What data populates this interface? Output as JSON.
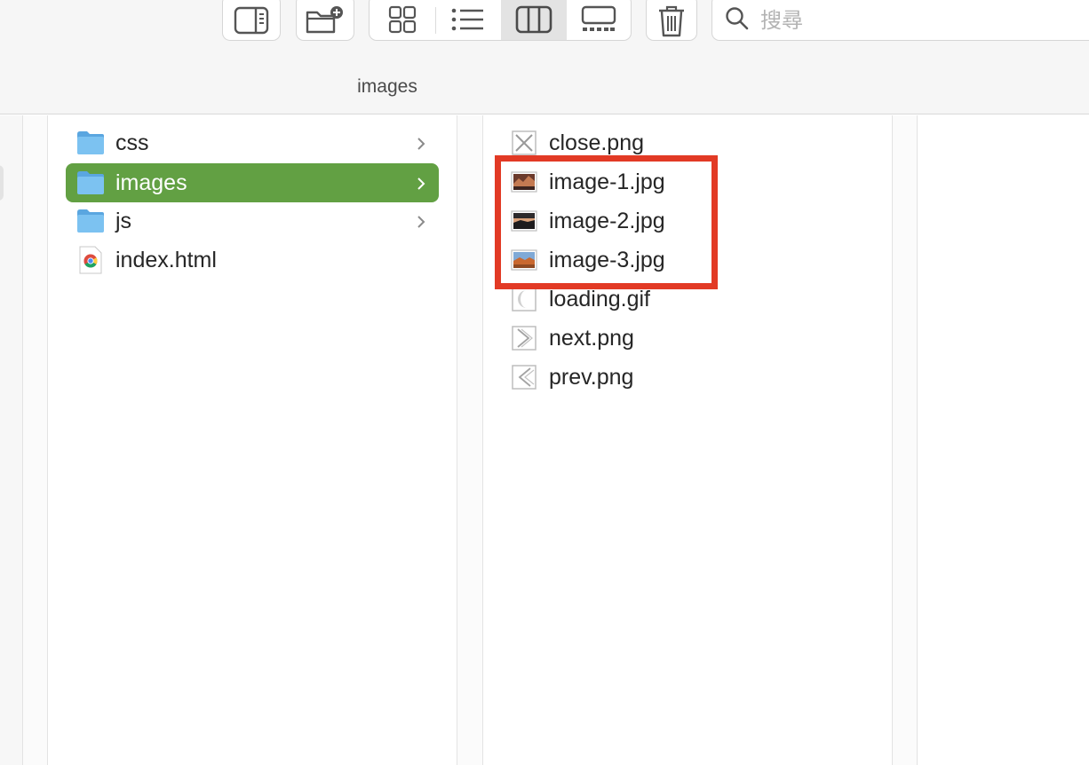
{
  "toolbar": {
    "buttons": [
      {
        "icon": "sidebar-toggle-icon"
      },
      {
        "icon": "new-folder-icon"
      },
      {
        "icon": "grid-view-icon"
      },
      {
        "icon": "list-view-icon"
      },
      {
        "icon": "column-view-icon"
      },
      {
        "icon": "gallery-view-icon"
      },
      {
        "icon": "trash-icon"
      }
    ],
    "search": {
      "placeholder": "搜尋",
      "value": ""
    },
    "path_title": "images"
  },
  "columns": {
    "folder_column": {
      "items": [
        {
          "label": "css",
          "icon": "folder-icon",
          "has_children": true,
          "selected": false
        },
        {
          "label": "images",
          "icon": "folder-icon",
          "has_children": true,
          "selected": true
        },
        {
          "label": "js",
          "icon": "folder-icon",
          "has_children": true,
          "selected": false
        },
        {
          "label": "index.html",
          "icon": "chrome-html-icon",
          "has_children": false,
          "selected": false
        }
      ]
    },
    "files_column": {
      "items": [
        {
          "label": "close.png",
          "icon": "close-image-icon"
        },
        {
          "label": "image-1.jpg",
          "icon": "photo-thumbnail-icon"
        },
        {
          "label": "image-2.jpg",
          "icon": "photo-thumbnail-icon"
        },
        {
          "label": "image-3.jpg",
          "icon": "photo-thumbnail-icon"
        },
        {
          "label": "loading.gif",
          "icon": "loading-image-icon"
        },
        {
          "label": "next.png",
          "icon": "next-arrow-image-icon"
        },
        {
          "label": "prev.png",
          "icon": "prev-arrow-image-icon"
        }
      ]
    }
  },
  "colors": {
    "selection": "#62a043",
    "highlight_border": "#e23a25",
    "folder": "#6fb7ea"
  }
}
